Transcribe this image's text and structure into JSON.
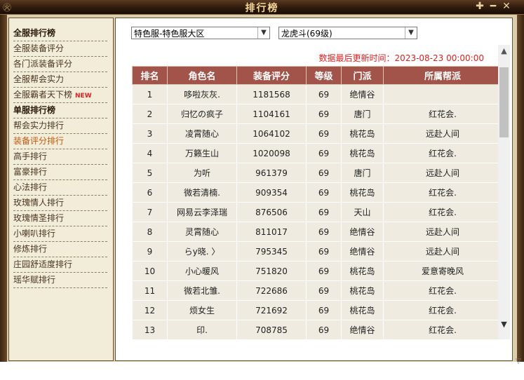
{
  "window": {
    "title": "排行榜",
    "deco": "㊋"
  },
  "sidebar": {
    "items": [
      {
        "label": "全服排行榜",
        "type": "header"
      },
      {
        "label": "全服装备评分",
        "type": "item"
      },
      {
        "label": "各门派装备评分",
        "type": "item"
      },
      {
        "label": "全服帮会实力",
        "type": "item"
      },
      {
        "label": "全服霸者天下榜",
        "type": "item",
        "badge": "NEW"
      },
      {
        "label": "单服排行榜",
        "type": "header"
      },
      {
        "label": "帮会实力排行",
        "type": "item"
      },
      {
        "label": "装备评分排行",
        "type": "active"
      },
      {
        "label": "高手排行",
        "type": "item"
      },
      {
        "label": "富豪排行",
        "type": "item"
      },
      {
        "label": "心法排行",
        "type": "item"
      },
      {
        "label": "玫瑰情人排行",
        "type": "item"
      },
      {
        "label": "玫瑰情圣排行",
        "type": "item"
      },
      {
        "label": "小喇叭排行",
        "type": "item"
      },
      {
        "label": "修炼排行",
        "type": "item"
      },
      {
        "label": "庄园舒适度排行",
        "type": "item"
      },
      {
        "label": "瑶华赋排行",
        "type": "item"
      }
    ]
  },
  "filters": {
    "server": "特色服-特色服大区",
    "category": "龙虎斗(69级)"
  },
  "update_time": "数据最后更新时间：2023-08-23 00:00:00",
  "table": {
    "headers": [
      "排名",
      "角色名",
      "装备评分",
      "等级",
      "门派",
      "所属帮派"
    ],
    "rows": [
      [
        "1",
        "哆啦灰灰.",
        "1181568",
        "69",
        "绝情谷",
        ""
      ],
      [
        "2",
        "归忆の疯子",
        "1104161",
        "69",
        "唐门",
        "红花会."
      ],
      [
        "3",
        "凌霄随心",
        "1064102",
        "69",
        "桃花岛",
        "远赴人间"
      ],
      [
        "4",
        "万籁生山",
        "1020098",
        "69",
        "桃花岛",
        "红花会."
      ],
      [
        "5",
        "为听",
        "961379",
        "69",
        "唐门",
        "远赴人间"
      ],
      [
        "6",
        "微若清楠.",
        "909354",
        "69",
        "桃花岛",
        "红花会."
      ],
      [
        "7",
        "网易云李泽瑞",
        "876506",
        "69",
        "天山",
        "红花会."
      ],
      [
        "8",
        "灵霄随心",
        "811017",
        "69",
        "绝情谷",
        "远赴人间"
      ],
      [
        "9",
        "らy晓. 〉",
        "795345",
        "69",
        "绝情谷",
        "远赴人间"
      ],
      [
        "10",
        "小心暖风",
        "751820",
        "69",
        "桃花岛",
        "爱意寄晚风"
      ],
      [
        "11",
        "微若北雏.",
        "722686",
        "69",
        "桃花岛",
        "红花会."
      ],
      [
        "12",
        "烦女生",
        "721692",
        "69",
        "桃花岛",
        "红花会."
      ],
      [
        "13",
        "印.",
        "708785",
        "69",
        "绝情谷",
        "红花会."
      ]
    ]
  },
  "icons": {
    "pin": "✚",
    "minimize": "━",
    "close": "✕",
    "dropdown": "▼",
    "scroll_up": "▲",
    "scroll_down": "▼",
    "outer_down": "▽"
  }
}
